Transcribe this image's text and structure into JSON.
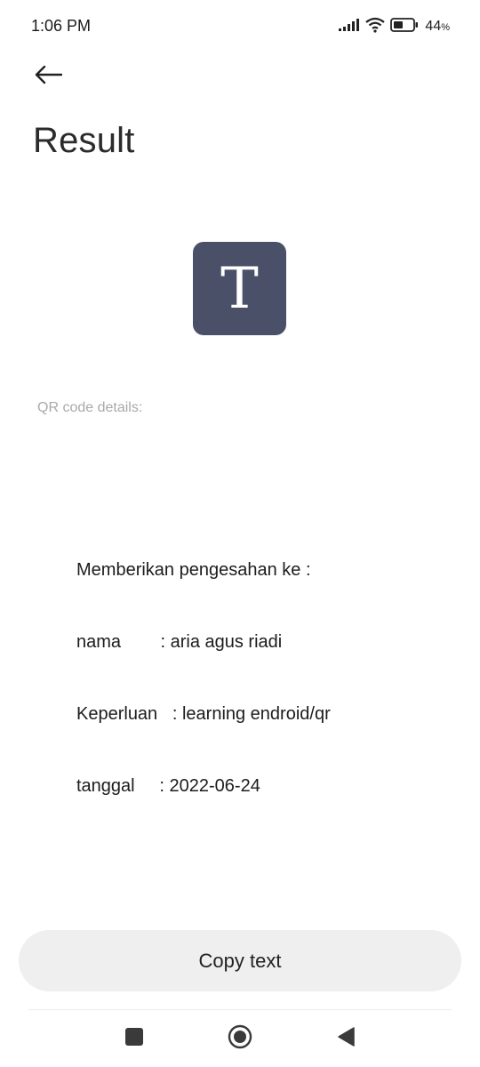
{
  "status_bar": {
    "time": "1:06 PM",
    "battery_percent": "44",
    "battery_suffix": "%"
  },
  "header": {
    "back_icon": "arrow-left-icon",
    "title": "Result"
  },
  "result": {
    "type_icon_letter": "T",
    "type_icon_color": "#4a5068",
    "details_label": "QR code details:",
    "qr_text_lines": [
      "Memberikan pengesahan ke :",
      "nama        : aria agus riadi",
      "Keperluan   : learning endroid/qr",
      "tanggal     : 2022-06-24"
    ]
  },
  "actions": {
    "copy_label": "Copy text"
  },
  "nav": {
    "recents_icon": "square-icon",
    "home_icon": "circle-icon",
    "back_icon": "triangle-back-icon"
  }
}
